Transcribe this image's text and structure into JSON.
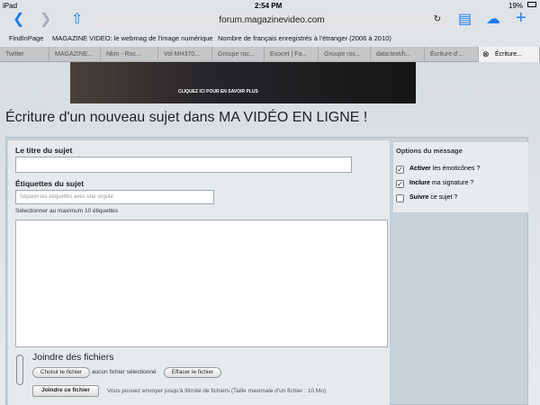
{
  "status": {
    "device": "iPad",
    "time": "2:54 PM",
    "battery": "19%"
  },
  "toolbar": {
    "url": "forum.magazinevideo.com"
  },
  "bookmarks": [
    "FindInPage",
    "MAGAZINE VIDEO: le webmag de l'image numérique",
    "Nombre de français enregistrés à l'étranger (2006 à 2010)"
  ],
  "tabs": [
    "Twitter",
    "MAGAZINE...",
    "Nkm - Roc...",
    "Vol MH370...",
    "Groupe roc...",
    "Exocet | Fa...",
    "Groupe roc...",
    "data:text/h...",
    "Écriture d'...",
    "Écriture..."
  ],
  "banner": {
    "cta": "CLIQUEZ ICI POUR EN SAVOIR PLUS"
  },
  "page": {
    "title": "Écriture d'un nouveau sujet dans MA VIDÉO EN LIGNE !"
  },
  "form": {
    "title_label": "Le titre du sujet",
    "tags_label": "Étiquettes du sujet",
    "tags_placeholder": "Séparer les étiquettes avec une virgule",
    "tags_hint": "Sélectionner au maximum 10 étiquettes",
    "attach_title": "Joindre des fichiers",
    "choose": "Choisir le fichier",
    "nofile": "aucun fichier sélectionné",
    "clear": "Effacer le fichier",
    "attach_btn": "Joindre ce fichier",
    "note": "Vous pouvez envoyer jusqu'à Illimité de fichiers (Taille maximale d'un fichier : 10 Mo)"
  },
  "options": {
    "title": "Options du message",
    "items": [
      {
        "strong": "Activer",
        "rest": " les émoticônes ?",
        "checked": true
      },
      {
        "strong": "Inclure",
        "rest": " ma signature ?",
        "checked": true
      },
      {
        "strong": "Suivre",
        "rest": " ce sujet ?",
        "checked": false
      }
    ]
  }
}
